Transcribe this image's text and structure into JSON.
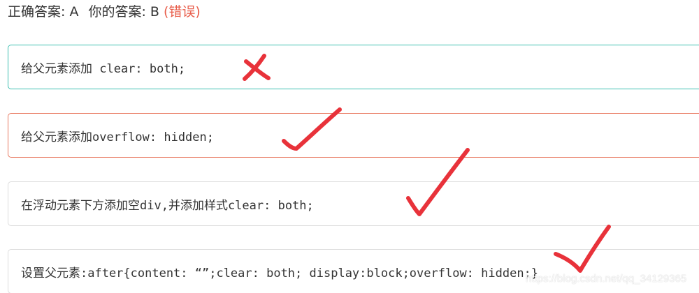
{
  "result": {
    "correct_label": "正确答案: A",
    "user_label": "你的答案: B",
    "status": "(错误)",
    "status_color": "#e85d4a"
  },
  "options": [
    {
      "text": "给父元素添加 clear: both;",
      "state": "correct",
      "mark": "cross-icon"
    },
    {
      "text": "给父元素添加overflow: hidden;",
      "state": "selected-wrong",
      "mark": "check-icon"
    },
    {
      "text": "在浮动元素下方添加空div,并添加样式clear: both;",
      "state": "normal",
      "mark": "check-icon"
    },
    {
      "text": "设置父元素:after{content: “”;clear: both; display:block;overflow: hidden;}",
      "state": "normal",
      "mark": "check-icon"
    }
  ],
  "colors": {
    "correct_border": "#3dbfb0",
    "selected_wrong_border": "#e8785f",
    "default_border": "#dcdcdc",
    "ink_mark": "#e8323a"
  },
  "watermark": "https://blog.csdn.net/qq_34129365"
}
